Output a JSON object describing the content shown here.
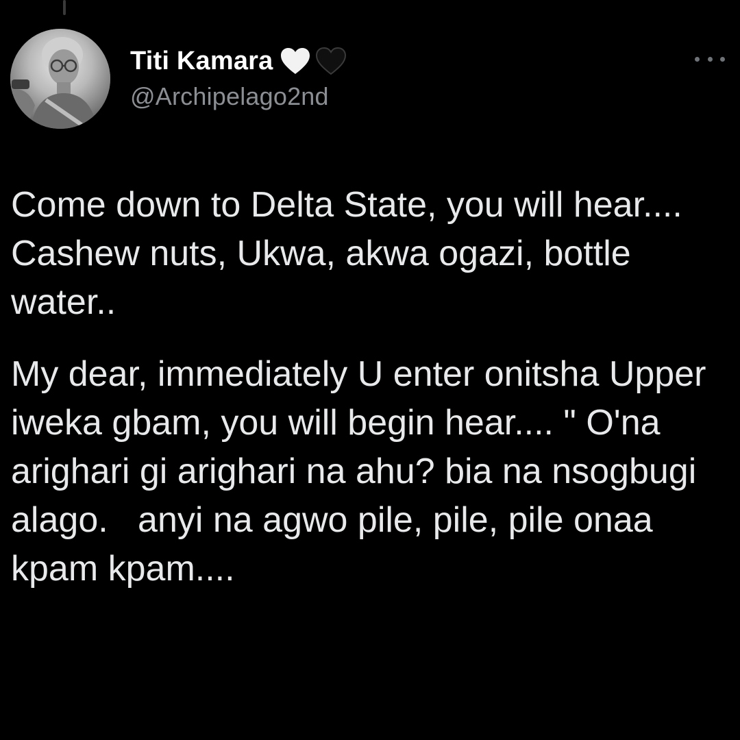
{
  "tweet": {
    "author": {
      "display_name": "Titi Kamara",
      "handle": "@Archipelago2nd",
      "name_emoji": [
        "white-heart-icon",
        "black-heart-icon"
      ]
    },
    "menu_icon": "more-horizontal-icon",
    "paragraphs": [
      "Come down to Delta State, you will hear.... Cashew nuts, Ukwa, akwa ogazi, bottle water..",
      "My dear, immediately U enter onitsha Upper iweka gbam, you will begin hear.... \" O'na arighari gi arighari na ahu? bia na nsogbugi alago.   anyi na agwo pile, pile, pile onaa kpam kpam...."
    ]
  },
  "colors": {
    "background": "#000000",
    "text_primary": "#e7e9ea",
    "text_secondary": "#8b8f94",
    "name": "#ffffff"
  }
}
